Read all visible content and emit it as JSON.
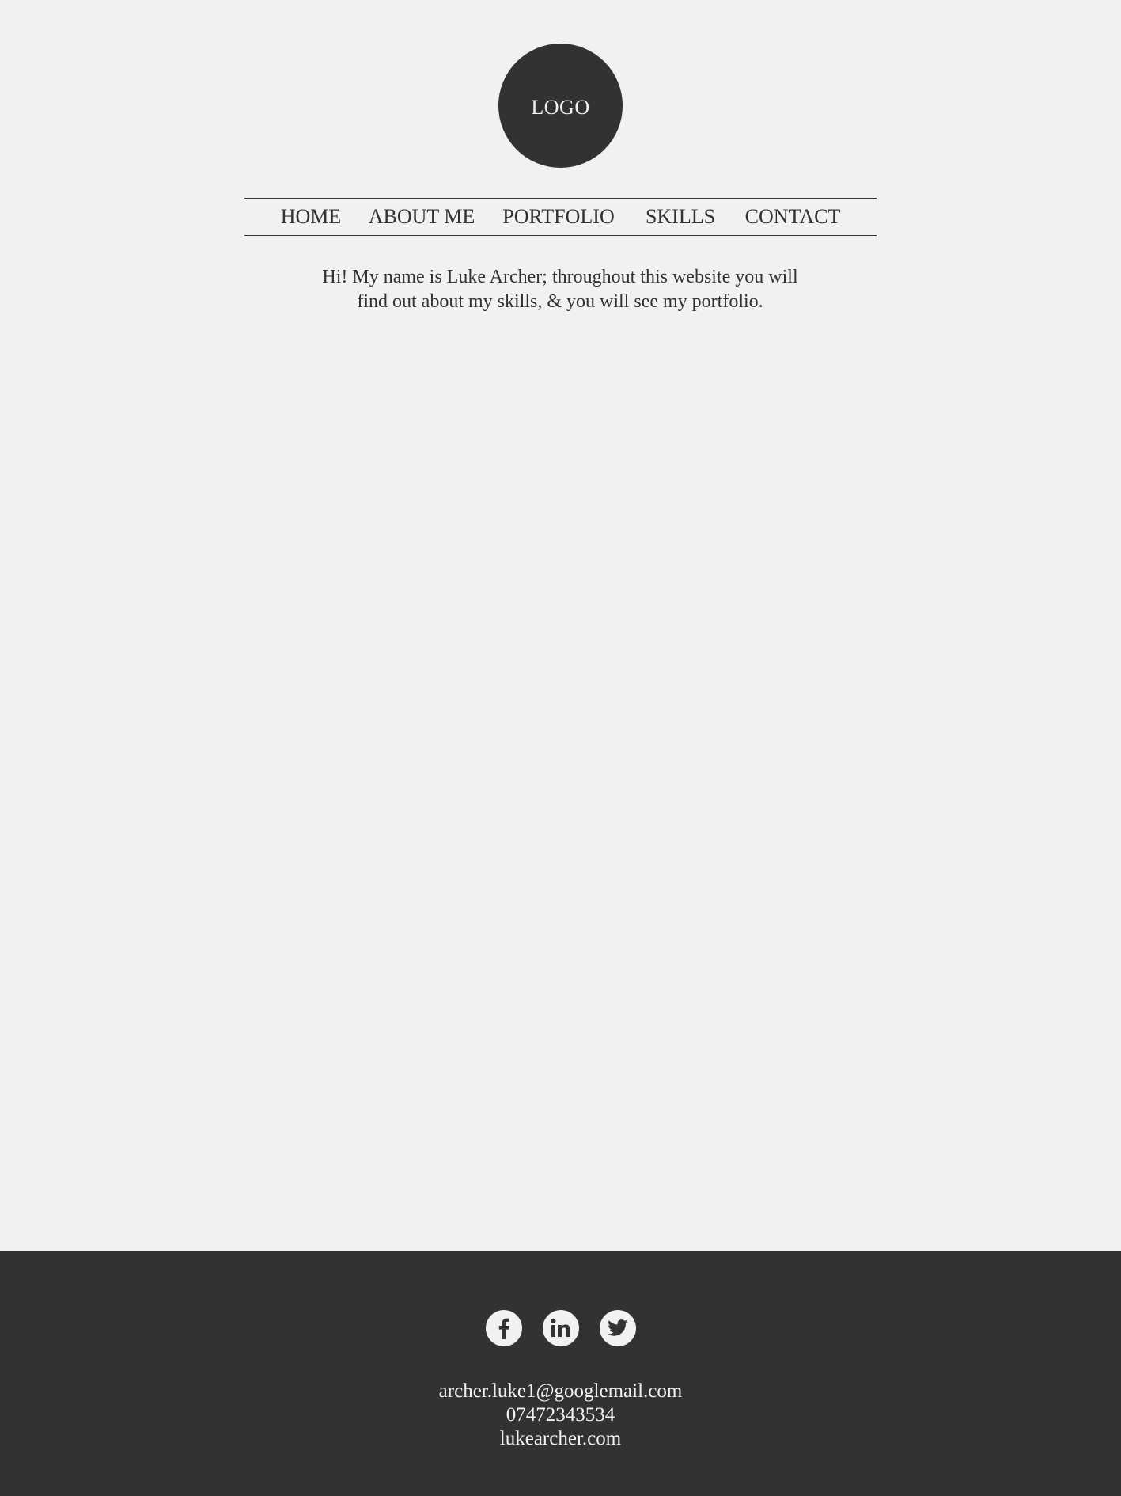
{
  "logo": {
    "text": "LOGO"
  },
  "nav": {
    "items": [
      {
        "label": "HOME"
      },
      {
        "label": "ABOUT ME"
      },
      {
        "label": "PORTFOLIO"
      },
      {
        "label": "SKILLS"
      },
      {
        "label": "CONTACT"
      }
    ]
  },
  "intro": {
    "line1": "Hi! My name is Luke Archer; throughout this website you will",
    "line2": "find out about my skills, & you will see my portfolio."
  },
  "footer": {
    "social_icons": [
      "facebook-icon",
      "linkedin-icon",
      "twitter-icon"
    ],
    "email": "archer.luke1@googlemail.com",
    "phone": "07472343534",
    "website": "lukearcher.com"
  },
  "colors": {
    "background": "#f1f1f1",
    "dark": "#323232",
    "light_text": "#f1f1f1"
  }
}
